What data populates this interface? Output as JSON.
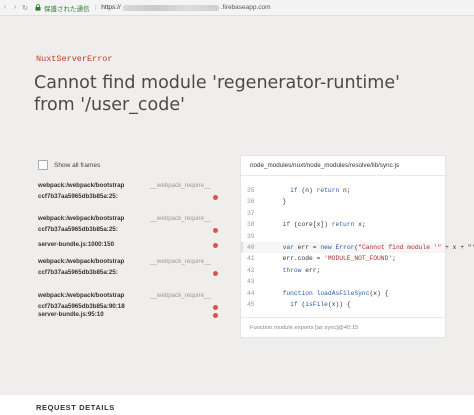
{
  "browser": {
    "secure_label": "保護された通信",
    "url_scheme": "https://",
    "url_host": ".firebaseapp.com"
  },
  "error": {
    "kind": "NuxtServerError",
    "message": "Cannot find module 'regenerator-runtime' from '/user_code'"
  },
  "stack": {
    "show_all_label": "Show all frames",
    "frames": [
      {
        "file": "webpack:/webpack/bootstrap",
        "fn": "__webpack_require__",
        "hash": "ccf7b37aa5965db3b85a:25:"
      },
      {
        "file": "webpack:/webpack/bootstrap",
        "fn": "__webpack_require__",
        "hash": "ccf7b37aa5965db3b85a:25:"
      },
      {
        "file": "server-bundle.js:1000:150",
        "fn": "",
        "hash": ""
      },
      {
        "file": "webpack:/webpack/bootstrap",
        "fn": "__webpack_require__",
        "hash": "ccf7b37aa5965db3b85a:25:"
      },
      {
        "file": "webpack:/webpack/bootstrap",
        "fn": "__webpack_require__",
        "hash": "ccf7b37aa5965db3b85a:90:18"
      },
      {
        "file": "server-bundle.js:95:10",
        "fn": "",
        "hash": ""
      }
    ]
  },
  "code": {
    "path": "node_modules/nuxt/node_modules/resolve/lib/sync.js",
    "lines": [
      {
        "n": "35",
        "text": "    if (n) return n;"
      },
      {
        "n": "36",
        "text": "  }"
      },
      {
        "n": "37",
        "text": ""
      },
      {
        "n": "38",
        "text": "  if (core[x]) return x;"
      },
      {
        "n": "39",
        "text": ""
      },
      {
        "n": "40",
        "text": "  var err = new Error(\"Cannot find module '\" + x + \"' from"
      },
      {
        "n": "41",
        "text": "  err.code = 'MODULE_NOT_FOUND';"
      },
      {
        "n": "42",
        "text": "  throw err;"
      },
      {
        "n": "43",
        "text": ""
      },
      {
        "n": "44",
        "text": "  function loadAsFileSync(x) {"
      },
      {
        "n": "45",
        "text": "    if (isFile(x)) {"
      }
    ],
    "highlight_line": "40",
    "footer": "Function.module.exports [as sync]@40:15"
  },
  "sections": {
    "request_details": "REQUEST DETAILS"
  }
}
